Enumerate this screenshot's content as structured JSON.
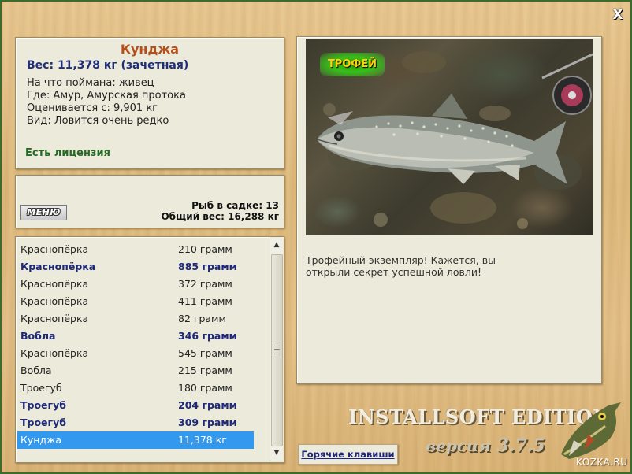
{
  "window": {
    "close_glyph": "X"
  },
  "fish_card": {
    "name": "Кунджа",
    "weight": "Вес: 11,378 кг (зачетная)",
    "lines": [
      "На что поймана: живец",
      "Где: Амур, Амурская протока",
      "Оценивается с: 9,901 кг",
      "Вид: Ловится очень редко"
    ],
    "license": "Есть лицензия"
  },
  "keepnet": {
    "menu_label": "МЕНЮ",
    "count": "Рыб в садке: 13",
    "total": "Общий вес: 16,288 кг"
  },
  "catch_list": [
    {
      "name": "Краснопёрка",
      "weight": "210 грамм",
      "style": "normal"
    },
    {
      "name": "Краснопёрка",
      "weight": "885 грамм",
      "style": "bold"
    },
    {
      "name": "Краснопёрка",
      "weight": "372 грамм",
      "style": "normal"
    },
    {
      "name": "Краснопёрка",
      "weight": "411 грамм",
      "style": "normal"
    },
    {
      "name": "Краснопёрка",
      "weight": "82 грамм",
      "style": "normal"
    },
    {
      "name": "Вобла",
      "weight": "346 грамм",
      "style": "bold"
    },
    {
      "name": "Краснопёрка",
      "weight": "545 грамм",
      "style": "normal"
    },
    {
      "name": "Вобла",
      "weight": "215 грамм",
      "style": "normal"
    },
    {
      "name": "Троегуб",
      "weight": "180 грамм",
      "style": "normal"
    },
    {
      "name": "Троегуб",
      "weight": "204 грамм",
      "style": "bold"
    },
    {
      "name": "Троегуб",
      "weight": "309 грамм",
      "style": "bold"
    },
    {
      "name": "Кунджа",
      "weight": "11,378 кг",
      "style": "selected"
    }
  ],
  "trophy": {
    "badge": "ТРОФЕЙ",
    "message": "Трофейный экземпляр! Кажется, вы открыли секрет успешной ловли!"
  },
  "footer": {
    "hotkeys": "Горячие клавиши",
    "edition": "INSTALLSOFT EDITION",
    "version_word": "версия",
    "version_number": "3.7.5",
    "site": "KOZKA.RU"
  },
  "colors": {
    "fish_name": "#b5501b",
    "weight": "#1f2e78",
    "license": "#236a23",
    "bold_row": "#1d2878",
    "selection": "#3399ee"
  }
}
